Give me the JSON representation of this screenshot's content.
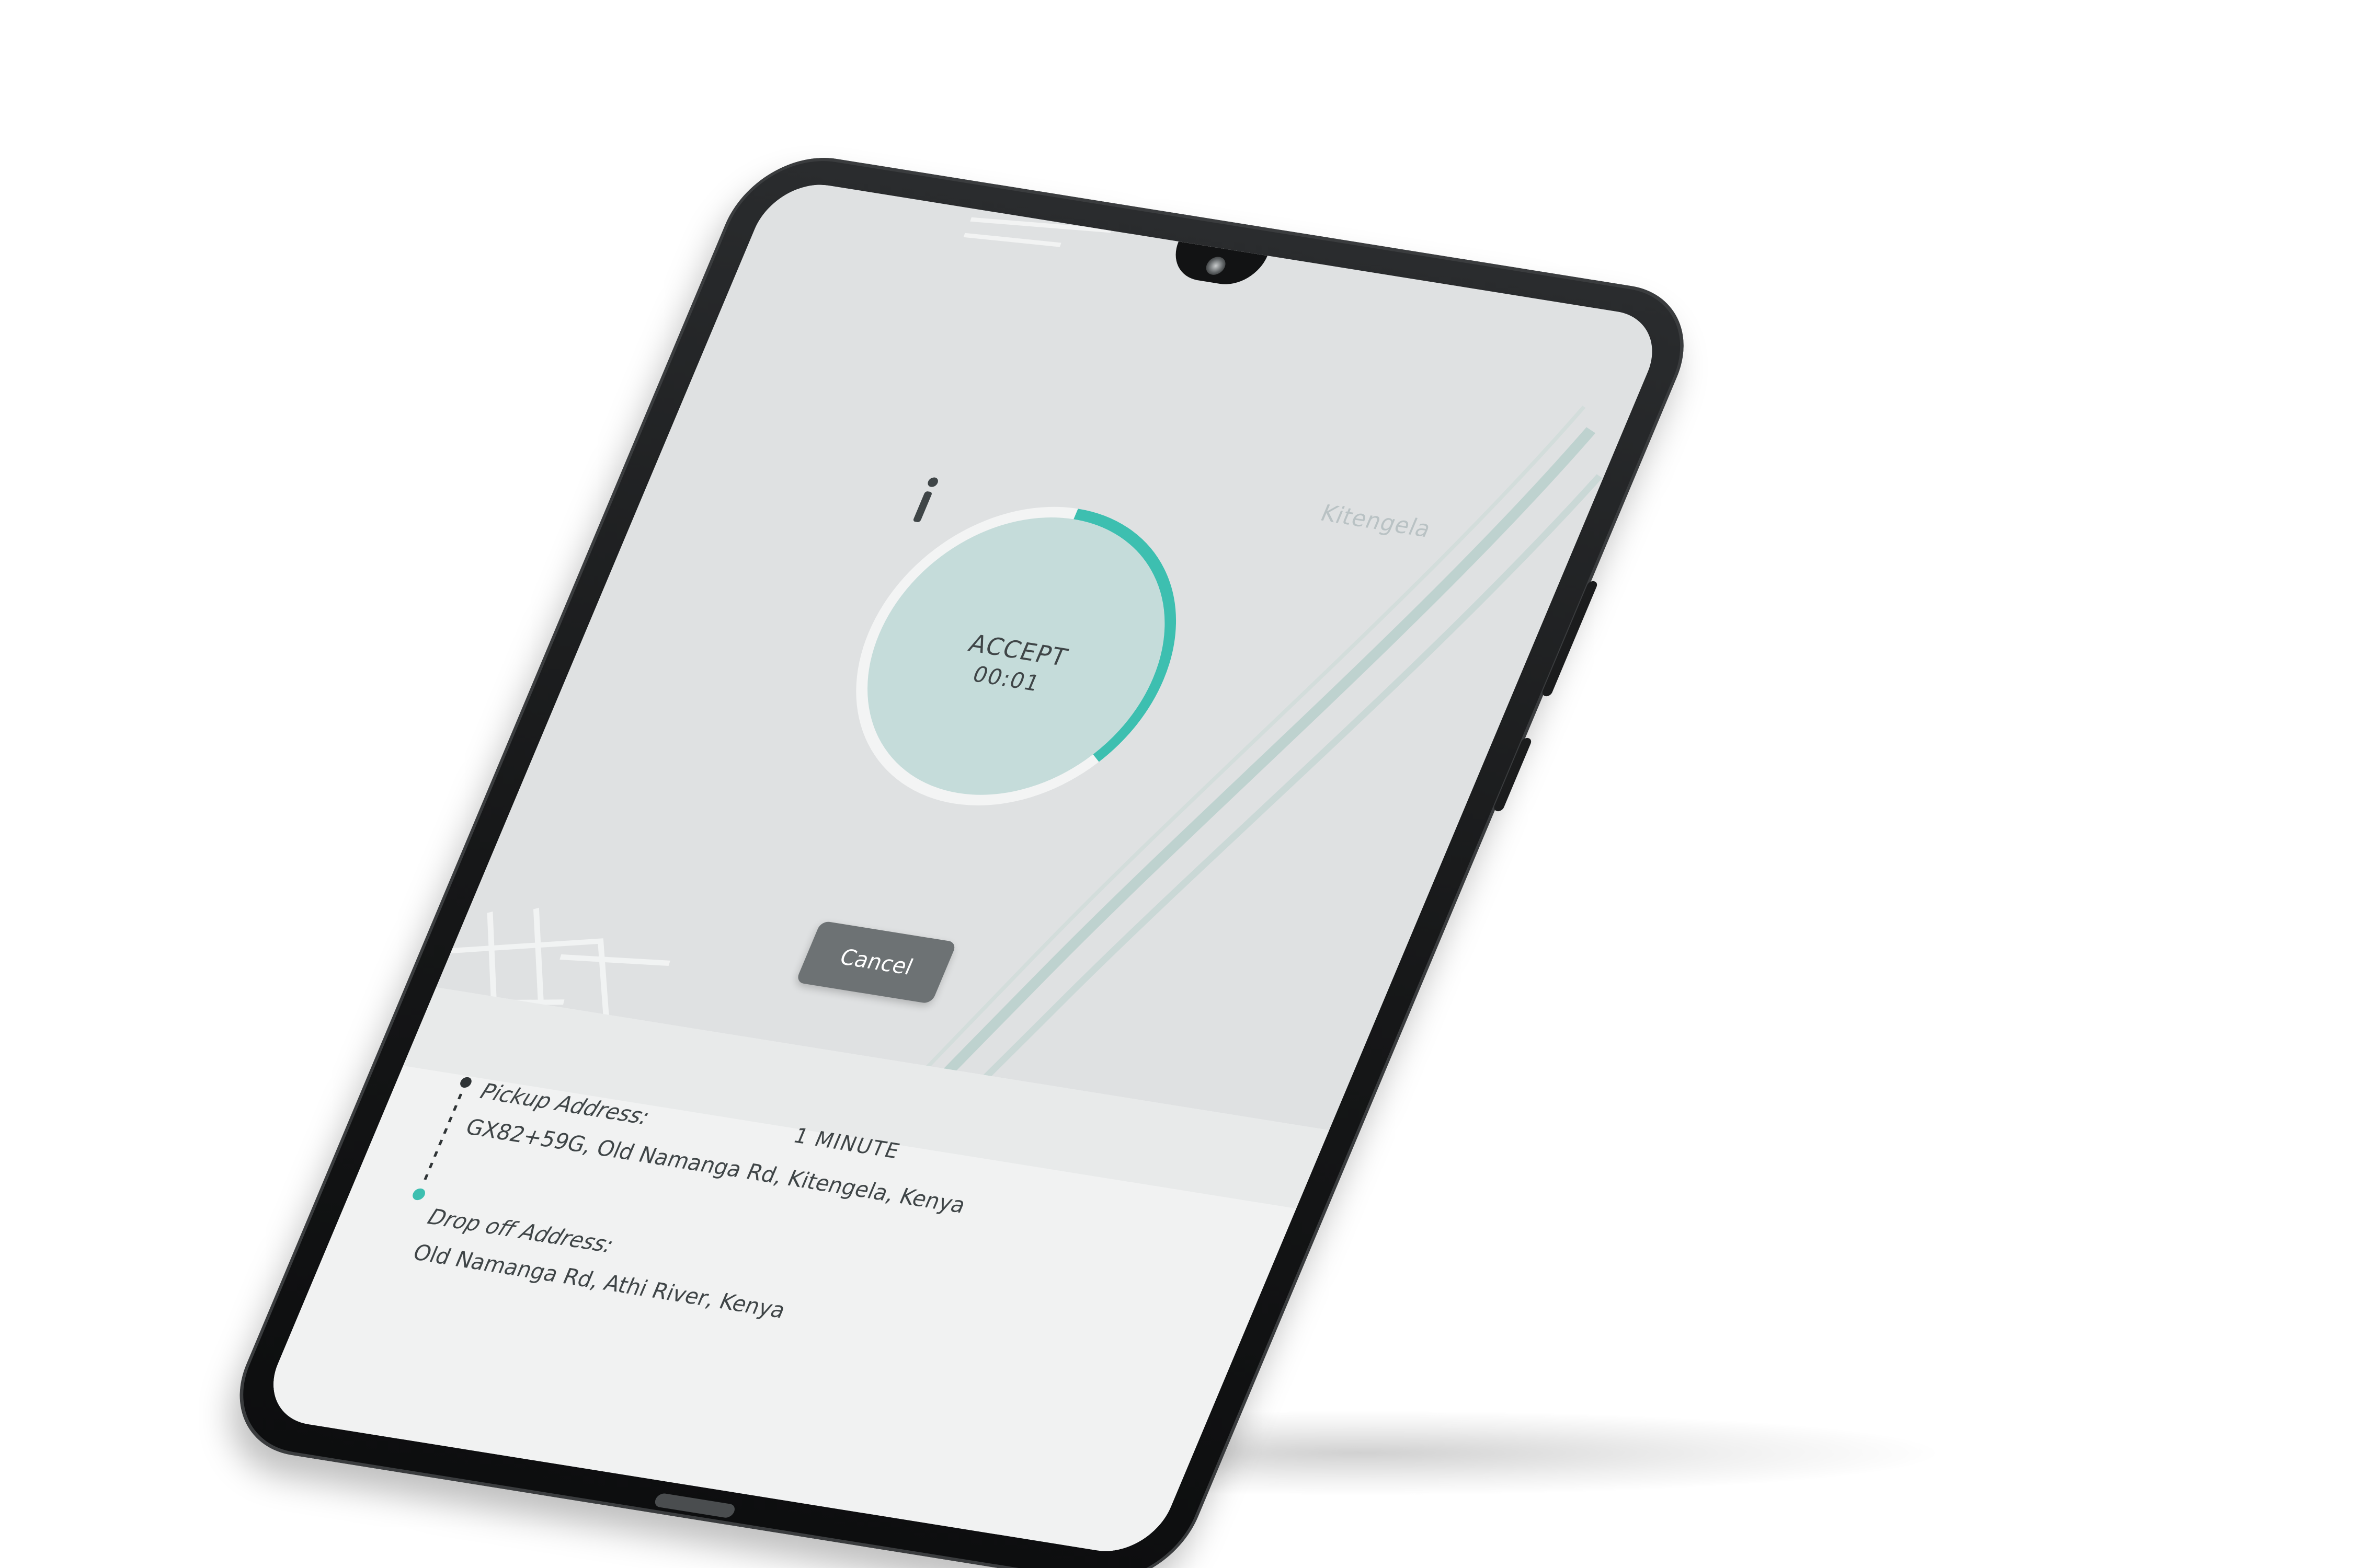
{
  "map": {
    "place_label": "Kitengela"
  },
  "timer": {
    "action_label": "ACCEPT",
    "elapsed": "00:01",
    "progress_fraction": 0.35,
    "accent_color": "#3dbfb0"
  },
  "cancel_button": {
    "label": "Cancel"
  },
  "trip": {
    "eta": "1 MINUTE",
    "pickup_label": "Pickup Address:",
    "pickup_value": "GX82+59G, Old Namanga Rd, Kitengela, Kenya",
    "dropoff_label": "Drop off Address:",
    "dropoff_value": "Old Namanga Rd, Athi River, Kenya"
  },
  "colors": {
    "accent": "#3dbfb0",
    "map_background": "#dfe1e2",
    "sheet_background": "#f1f2f2",
    "text": "#3f4547"
  },
  "icons": {
    "timer_center": "info-icon",
    "pickup_marker": "dark-dot-icon",
    "dropoff_marker": "teal-dot-icon"
  }
}
